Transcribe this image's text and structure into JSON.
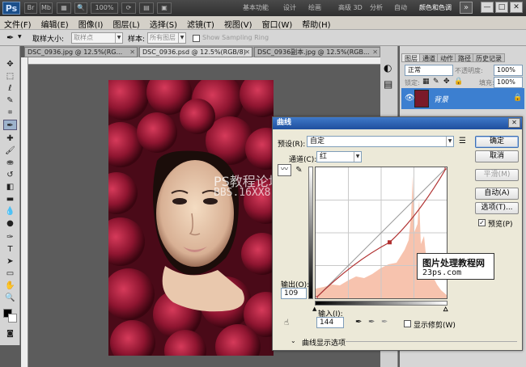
{
  "app": {
    "logo": "Ps",
    "zoom": "100%",
    "workspaces": [
      "基本功能",
      "设计",
      "绘画",
      "摄影",
      "高级 3D",
      "分析",
      "自动",
      "颜色和色调"
    ],
    "active_workspace": "颜色和色调",
    "overflow": "»",
    "window_controls": [
      "—",
      "□",
      "✕"
    ]
  },
  "menubar": {
    "items": [
      "文件(F)",
      "编辑(E)",
      "图像(I)",
      "图层(L)",
      "选择(S)",
      "滤镜(T)",
      "视图(V)",
      "窗口(W)",
      "帮助(H)"
    ]
  },
  "options": {
    "sample_size_label": "取样大小:",
    "sample_size_value": "取样点",
    "sample_label": "样本:",
    "sample_value": "所有图层",
    "sampling_ring_label": "Show Sampling Ring"
  },
  "tabs": [
    {
      "label": "DSC_0936.jpg @ 12.5%(RG...",
      "active": false
    },
    {
      "label": "DSC_0936.psd @ 12.5%(RGB/8)",
      "active": true
    },
    {
      "label": "DSC_0936副本.jpg @ 12.5%(RGB...",
      "active": false
    }
  ],
  "canvas": {
    "watermark_line1": "PS教程论坛",
    "watermark_line2": "BBS.16XX8.COM"
  },
  "panels": {
    "tabs": [
      "图层",
      "通道",
      "动作",
      "路径",
      "历史记录"
    ],
    "blend_mode": "正常",
    "opacity_label": "不透明度:",
    "opacity_value": "100%",
    "lock_label": "锁定:",
    "fill_label": "填充:",
    "fill_value": "100%",
    "layer_name": "背景"
  },
  "curves": {
    "title": "曲线",
    "preset_label": "预设(R):",
    "preset_value": "自定",
    "channel_label": "通道(C):",
    "channel_value": "红",
    "output_label": "输出(O):",
    "output_value": "109",
    "input_label": "输入(I):",
    "input_value": "144",
    "show_clipping_label": "显示修剪(W)",
    "display_options_label": "曲线显示选项",
    "buttons": {
      "ok": "确定",
      "cancel": "取消",
      "smooth": "平滑(M)",
      "auto": "自动(A)",
      "options": "选项(T)...",
      "preview": "预览(P)"
    },
    "preview_checked": true,
    "curve_points": [
      [
        0,
        0
      ],
      [
        144,
        109
      ],
      [
        255,
        255
      ]
    ]
  },
  "site_watermark": {
    "line1": "图片处理教程网",
    "line2": "23ps.com"
  }
}
